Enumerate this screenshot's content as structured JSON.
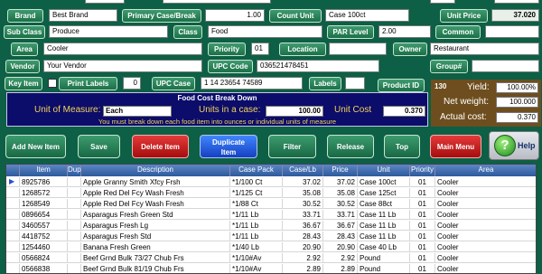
{
  "fields": {
    "brand_label": "Brand",
    "brand_value": "Best Brand",
    "primary_case_label": "Primary Case/Break",
    "primary_case_value": "1.00",
    "count_unit_label": "Count Unit",
    "count_unit_value": "Case 100ct",
    "unit_price_label": "Unit Price",
    "unit_price_value": "37.020",
    "sub_class_label": "Sub Class",
    "sub_class_value": "Produce",
    "class_label": "Class",
    "class_value": "Food",
    "par_level_label": "PAR Level",
    "par_level_value": "2.00",
    "common_label": "Common",
    "common_value": "",
    "area_label": "Area",
    "area_value": "Cooler",
    "priority_label": "Priority",
    "priority_value": "01",
    "location_label": "Location",
    "location_value": "",
    "owner_label": "Owner",
    "owner_value": "Restaurant",
    "vendor_label": "Vendor",
    "vendor_value": "Your Vendor",
    "upc_code_label": "UPC Code",
    "upc_code_value": "036521478451",
    "group_label": "Group#",
    "group_value": "",
    "key_item_label": "Key Item",
    "print_labels_label": "Print Labels",
    "print_labels_value": "0",
    "upc_case_label": "UPC Case",
    "upc_case_value": "1 14 23654 74589",
    "labels_label": "Labels",
    "labels_value": "",
    "product_id_label": "Product ID",
    "product_id_value": "130"
  },
  "food_cost": {
    "title": "Food Cost Break Down",
    "unit_of_measure_label": "Unit of Measure:",
    "unit_of_measure_value": "Each",
    "units_in_case_label": "Units in a case:",
    "units_in_case_value": "100.00",
    "unit_cost_label": "Unit Cost",
    "unit_cost_value": "0.370",
    "note": "You must break down each food item into ounces or individual units of measure"
  },
  "yield_box": {
    "yield_label": "Yield:",
    "yield_value": "100.00%",
    "net_weight_label": "Net weight:",
    "net_weight_value": "100.000",
    "actual_cost_label": "Actual cost:",
    "actual_cost_value": "0.370"
  },
  "buttons": {
    "add_new_item": "Add New Item",
    "save": "Save",
    "delete_item": "Delete Item",
    "duplicate_item_1": "Duplicate",
    "duplicate_item_2": "Item",
    "filter": "Filter",
    "release": "Release",
    "top": "Top",
    "main_menu": "Main Menu",
    "help": "Help"
  },
  "table": {
    "headers": [
      "Item",
      "Dup",
      "Description",
      "Case Pack",
      "Case/Lb",
      "Price",
      "Unit",
      "Priority",
      "Area"
    ],
    "rows": [
      [
        "8925786",
        "",
        "Apple Granny Smith Xfcy Frsh",
        "*1/100 Ct",
        "37.02",
        "37.02",
        "Case 100ct",
        "01",
        "Cooler"
      ],
      [
        "1268572",
        "",
        "Apple Red Del Fcy Wash Fresh",
        "*1/125 Ct",
        "35.08",
        "35.08",
        "Case 125ct",
        "01",
        "Cooler"
      ],
      [
        "1268549",
        "",
        "Apple Red Del Fcy Wash Fresh",
        "*1/88 Ct",
        "30.52",
        "30.52",
        "Case 88ct",
        "01",
        "Cooler"
      ],
      [
        "0896654",
        "",
        "Asparagus Fresh Green Std",
        "*1/11 Lb",
        "33.71",
        "33.71",
        "Case 11 Lb",
        "01",
        "Cooler"
      ],
      [
        "3460557",
        "",
        "Asparagus Fresh Lg",
        "*1/11 Lb",
        "36.67",
        "36.67",
        "Case 11 Lb",
        "01",
        "Cooler"
      ],
      [
        "4418752",
        "",
        "Asparagus Fresh Std",
        "*1/11 Lb",
        "28.43",
        "28.43",
        "Case 11 Lb",
        "01",
        "Cooler"
      ],
      [
        "1254460",
        "",
        "Banana Fresh Green",
        "*1/40 Lb",
        "20.90",
        "20.90",
        "Case 40 Lb",
        "01",
        "Cooler"
      ],
      [
        "0566824",
        "",
        "Beef Grnd Bulk 73/27 Chub Frs",
        "*1/10#Av",
        "2.92",
        "2.92",
        "Pound",
        "01",
        "Cooler"
      ],
      [
        "0566838",
        "",
        "Beef Grnd Bulk 81/19 Chub Frs",
        "*1/10#Av",
        "2.89",
        "2.89",
        "Pound",
        "01",
        "Cooler"
      ]
    ]
  }
}
